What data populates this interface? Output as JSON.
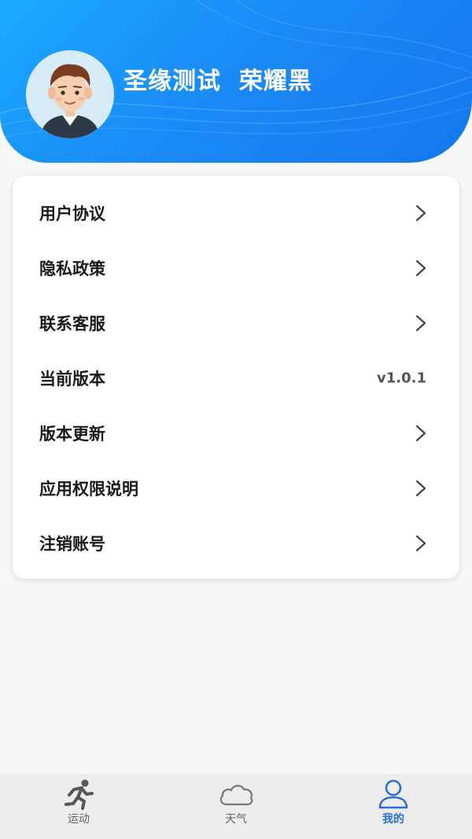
{
  "profile": {
    "username": "圣缘测试  荣耀黑"
  },
  "menu": {
    "items": [
      {
        "label": "用户协议",
        "value": null
      },
      {
        "label": "隐私政策",
        "value": null
      },
      {
        "label": "联系客服",
        "value": null
      },
      {
        "label": "当前版本",
        "value": "v1.0.1"
      },
      {
        "label": "版本更新",
        "value": null
      },
      {
        "label": "应用权限说明",
        "value": null
      },
      {
        "label": "注销账号",
        "value": null
      }
    ]
  },
  "tabbar": {
    "tabs": [
      {
        "label": "运动",
        "icon": "running-icon",
        "active": false
      },
      {
        "label": "天气",
        "icon": "cloud-icon",
        "active": false
      },
      {
        "label": "我的",
        "icon": "user-icon",
        "active": true
      }
    ]
  },
  "colors": {
    "header_gradient_start": "#1aa9ff",
    "header_gradient_end": "#1677ee",
    "active_tab": "#2a6fd6"
  }
}
